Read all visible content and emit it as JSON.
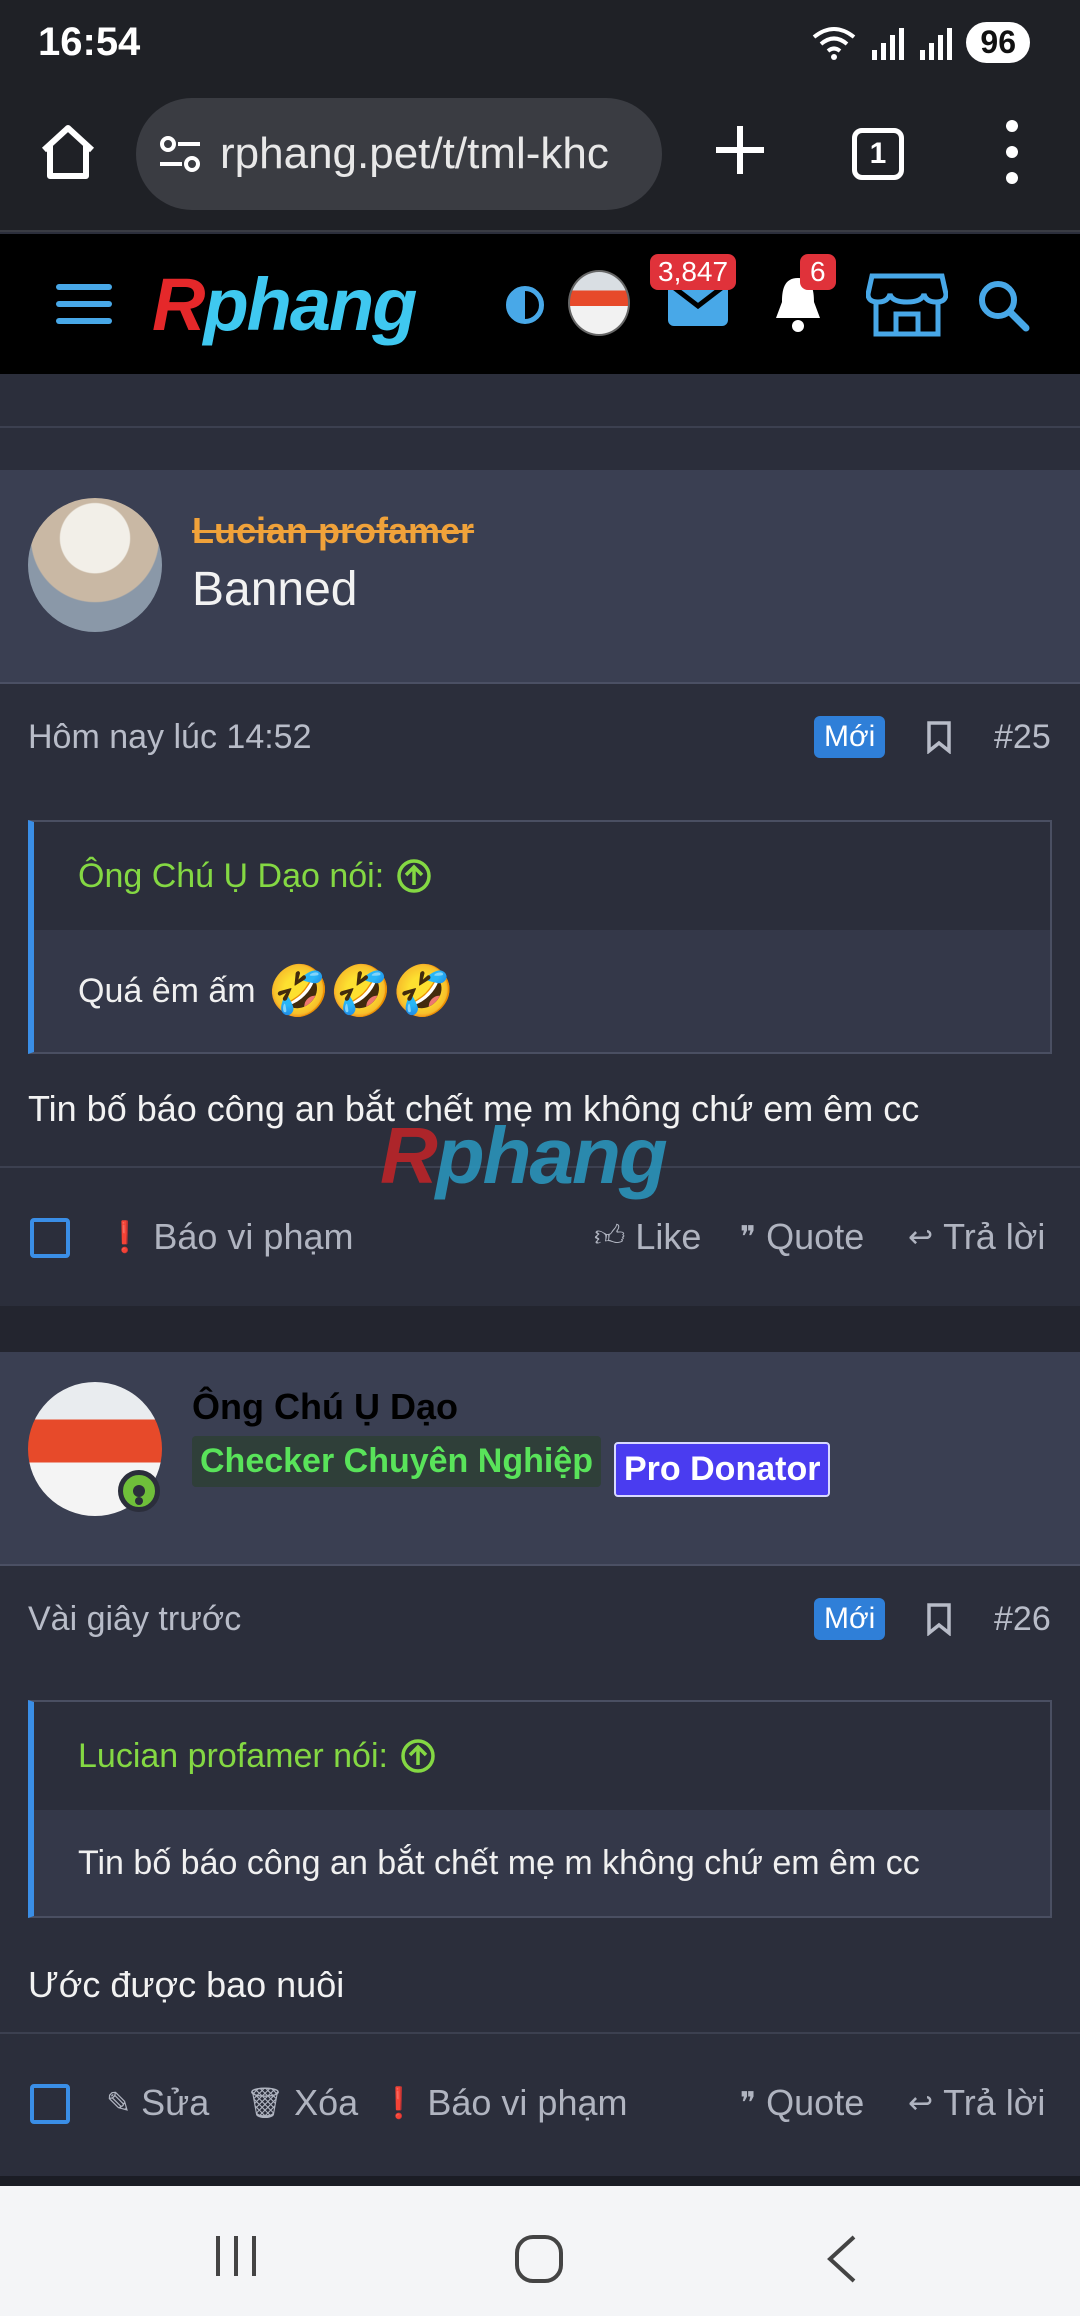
{
  "status": {
    "time": "16:54",
    "battery": "96"
  },
  "browser": {
    "url": "rphang.pet/t/tml-khc",
    "tab_count": "1"
  },
  "site": {
    "logo_r": "R",
    "logo_rest": "phang",
    "mail_count": "3,847",
    "notification_count": "6"
  },
  "posts": [
    {
      "username": "Lucian profamer",
      "status_label": "Banned",
      "time": "Hôm nay lúc 14:52",
      "new_label": "Mới",
      "number": "#25",
      "quote_author": "Ông Chú Ụ Dạo nói:",
      "quote_text": "Quá êm ấm",
      "quote_emoji": "🤣🤣🤣",
      "text": "Tin bố báo công an bắt chết mẹ m không chứ em êm cc",
      "actions": {
        "report": "Báo vi phạm",
        "like": "Like",
        "quote": "Quote",
        "reply": "Trả lời"
      }
    },
    {
      "username": "Ông Chú Ụ Dạo",
      "roles": [
        "Checker Chuyên Nghiệp",
        "Pro Donator"
      ],
      "time": "Vài giây trước",
      "new_label": "Mới",
      "number": "#26",
      "quote_author": "Lucian profamer nói:",
      "quote_text": "Tin bố báo công an bắt chết mẹ m không chứ em êm cc",
      "text": "Ước được bao nuôi",
      "actions": {
        "edit": "Sửa",
        "delete": "Xóa",
        "report": "Báo vi phạm",
        "quote": "Quote",
        "reply": "Trả lời"
      }
    }
  ],
  "colors": {
    "accent": "#3a8ee6",
    "quote_author": "#84d843",
    "badge_red": "#e0323a",
    "banned_name": "#f0a23a"
  }
}
